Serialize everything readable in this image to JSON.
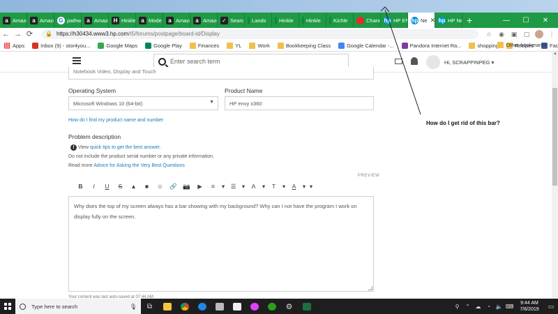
{
  "browser": {
    "tabs": [
      {
        "label": "Amazo",
        "icon": "amazon-icon",
        "active": false
      },
      {
        "label": "Amazo",
        "icon": "amazon-icon",
        "active": false
      },
      {
        "label": "pathw",
        "icon": "google-icon",
        "active": false
      },
      {
        "label": "Amazo",
        "icon": "amazon-icon",
        "active": false
      },
      {
        "label": "Hinkle",
        "icon": "hinkle-icon",
        "active": false
      },
      {
        "label": "Mode",
        "icon": "amazon-icon",
        "active": false
      },
      {
        "label": "Amazo",
        "icon": "amazon-icon",
        "active": false
      },
      {
        "label": "Amazo",
        "icon": "amazon-icon",
        "active": false
      },
      {
        "label": "Search",
        "icon": "search-tab-icon",
        "active": false
      },
      {
        "label": "Lands",
        "icon": "site-icon",
        "active": false
      },
      {
        "label": "Hinkle",
        "icon": "site-icon",
        "active": false
      },
      {
        "label": "Hinkle",
        "icon": "site-icon",
        "active": false
      },
      {
        "label": "Kichle",
        "icon": "site-icon",
        "active": false
      },
      {
        "label": "Chann",
        "icon": "youtube-icon",
        "active": false
      },
      {
        "label": "HP EN",
        "icon": "hp-icon",
        "active": false
      },
      {
        "label": "Ne",
        "icon": "hp-icon",
        "active": true
      },
      {
        "label": "HP Ne",
        "icon": "hp-icon",
        "active": false
      }
    ],
    "new_tab": "+",
    "window_controls": {
      "minimize": "—",
      "maximize": "☐",
      "close": "✕"
    },
    "nav": {
      "back": "←",
      "forward": "→",
      "reload": "⟳"
    },
    "url": {
      "host": "https://h30434.www3.hp.com",
      "path": "/t5/forums/postpage/board-id/Display"
    },
    "bookmarks": [
      {
        "label": "Apps",
        "icon": "apps-icon"
      },
      {
        "label": "Inbox (9) - stor4you...",
        "icon": "gmail-icon"
      },
      {
        "label": "Google Maps",
        "icon": "maps-icon"
      },
      {
        "label": "Google Play",
        "icon": "play-icon"
      },
      {
        "label": "Finances",
        "icon": "folder-icon"
      },
      {
        "label": "YL",
        "icon": "folder-icon"
      },
      {
        "label": "Work",
        "icon": "folder-icon"
      },
      {
        "label": "Bookkeeping Class",
        "icon": "folder-icon"
      },
      {
        "label": "Google Calendar -...",
        "icon": "calendar-icon"
      },
      {
        "label": "Pandora Internet Ra...",
        "icon": "pandora-icon"
      },
      {
        "label": "shopping",
        "icon": "folder-icon"
      },
      {
        "label": "Recipes",
        "icon": "folder-icon"
      },
      {
        "label": "Facebook",
        "icon": "facebook-icon"
      }
    ],
    "other_bookmarks": "Other bookmarks"
  },
  "header": {
    "search_placeholder": "Enter search term",
    "user_name": "Hi, SCRAPPINPEG"
  },
  "form": {
    "top_field_value": "Notebook Video, Display and Touch",
    "os_label": "Operating System",
    "os_value": "Microsoft Windows 10 (64-bit)",
    "product_label": "Product Name",
    "product_value": "HP envy x360",
    "find_product_link": "How do I find my product name and number",
    "problem_label": "Problem description",
    "view_prefix": "View",
    "tips_link": "quick tips to get the best answer",
    "tips_suffix": ".",
    "serial_note": "Do not include the product serial number or any private information.",
    "read_more": "Read more",
    "advice_link": "Advice for Asking the Very Best Questions",
    "preview": "PREVIEW",
    "editor_text": "Why does the top of my screen always has a bar showing with my background?  Why can I not have the program I work on display fully on the screen.",
    "autosave_note": "Your content was last auto-saved at 07:44 AM"
  },
  "toolbar_buttons": [
    "B",
    "I",
    "U",
    "S",
    "▲",
    "■",
    "☺",
    "🔗",
    "📷",
    "▶",
    "≡",
    "▾",
    "☰",
    "▾",
    "A",
    "▾",
    "T",
    "▾",
    "A",
    "▾",
    "▾"
  ],
  "annotation": "How do I get rid of this bar?",
  "taskbar": {
    "search_placeholder": "Type here to search",
    "time": "9:44 AM",
    "date": "7/6/2019"
  },
  "colors": {
    "tab_bar": "#1f9a45",
    "link": "#1a7ab8",
    "taskbar": "#1e1e1e"
  }
}
